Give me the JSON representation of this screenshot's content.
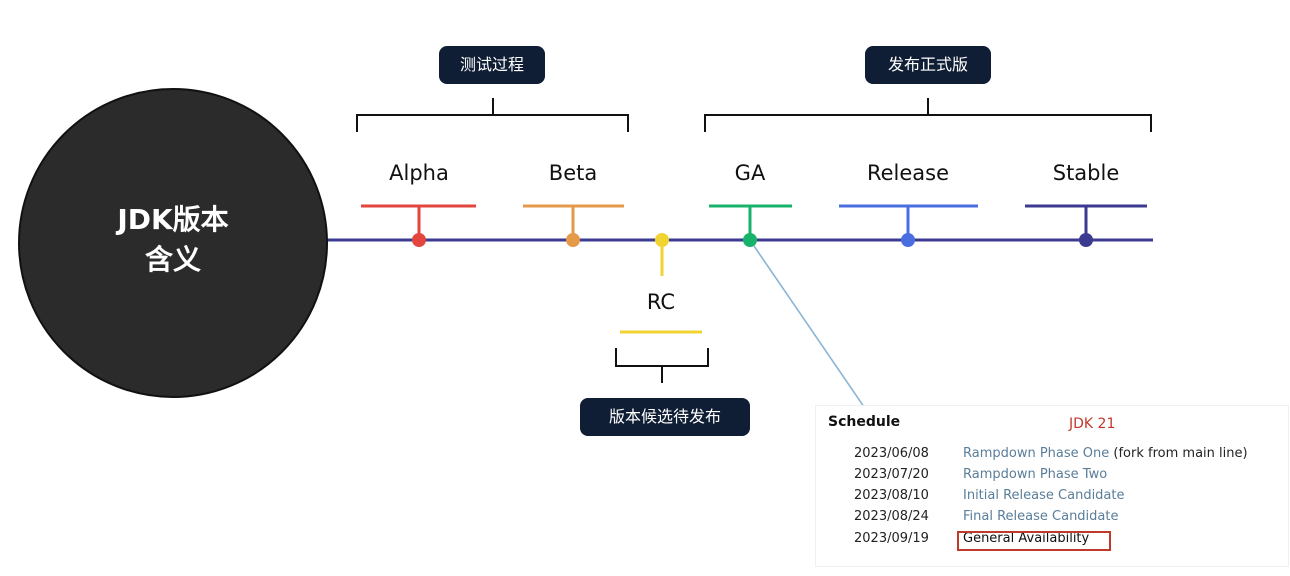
{
  "center": {
    "line1": "JDK版本",
    "line2": "含义"
  },
  "groups": {
    "testing": "测试过程",
    "release": "发布正式版",
    "candidate": "版本候选待发布"
  },
  "stages": [
    {
      "key": "alpha",
      "label": "Alpha",
      "color": "#e2463f"
    },
    {
      "key": "beta",
      "label": "Beta",
      "color": "#e59a4a"
    },
    {
      "key": "rc",
      "label": "RC",
      "color": "#f1d331"
    },
    {
      "key": "ga",
      "label": "GA",
      "color": "#17b36b"
    },
    {
      "key": "release",
      "label": "Release",
      "color": "#4a6ee0"
    },
    {
      "key": "stable",
      "label": "Stable",
      "color": "#3d3a92"
    }
  ],
  "timeline_color": "#3d3a92",
  "schedule": {
    "title": "Schedule",
    "release": "JDK 21",
    "rows": [
      {
        "date": "2023/06/08",
        "event": "Rampdown Phase One",
        "note": "(fork from main line)"
      },
      {
        "date": "2023/07/20",
        "event": "Rampdown Phase Two",
        "note": ""
      },
      {
        "date": "2023/08/10",
        "event": "Initial Release Candidate",
        "note": ""
      },
      {
        "date": "2023/08/24",
        "event": "Final Release Candidate",
        "note": ""
      },
      {
        "date": "2023/09/19",
        "event": "General Availability",
        "note": "",
        "highlighted": true
      }
    ]
  }
}
